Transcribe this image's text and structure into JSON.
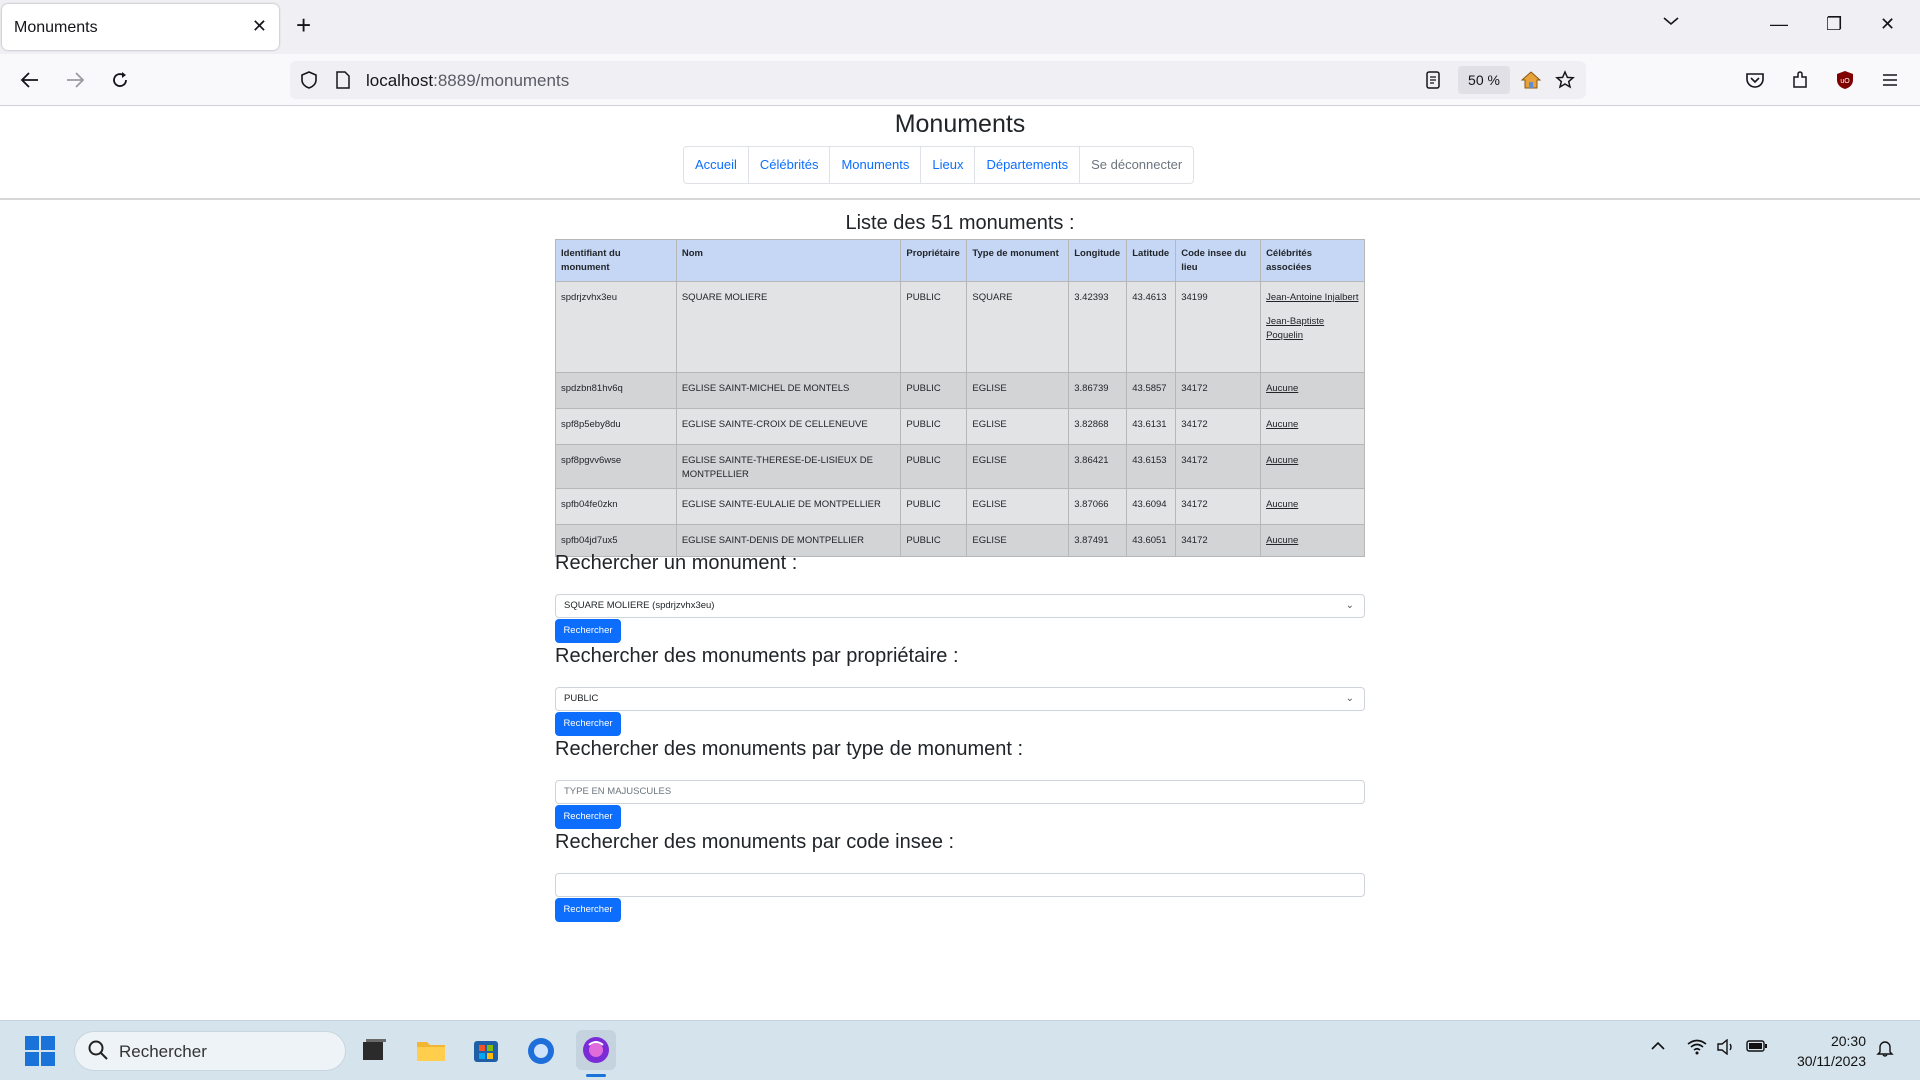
{
  "browser": {
    "tab_title": "Monuments",
    "url_host": "localhost",
    "url_rest": ":8889/monuments",
    "zoom": "50 %"
  },
  "page": {
    "title": "Monuments",
    "menu": [
      "Accueil",
      "Célébrités",
      "Monuments",
      "Lieux",
      "Départements",
      "Se déconnecter"
    ],
    "list_title": "Liste des 51 monuments :",
    "table": {
      "headers": [
        "Identifiant du monument",
        "Nom",
        "Propriétaire",
        "Type de monument",
        "Longitude",
        "Latitude",
        "Code insee du lieu",
        "Célébrités associées"
      ],
      "rows": [
        {
          "id": "spdrjzvhx3eu",
          "nom": "SQUARE MOLIERE",
          "proprietaire": "PUBLIC",
          "type": "SQUARE",
          "longitude": "3.42393",
          "latitude": "43.4613",
          "insee": "34199",
          "celebrites": [
            "Jean-Antoine Injalbert",
            "Jean-Baptiste Poquelin"
          ]
        },
        {
          "id": "spdzbn81hv6q",
          "nom": "EGLISE SAINT-MICHEL DE MONTELS",
          "proprietaire": "PUBLIC",
          "type": "EGLISE",
          "longitude": "3.86739",
          "latitude": "43.5857",
          "insee": "34172",
          "celebrites": [
            "Aucune"
          ]
        },
        {
          "id": "spf8p5eby8du",
          "nom": "EGLISE SAINTE-CROIX DE CELLENEUVE",
          "proprietaire": "PUBLIC",
          "type": "EGLISE",
          "longitude": "3.82868",
          "latitude": "43.6131",
          "insee": "34172",
          "celebrites": [
            "Aucune"
          ]
        },
        {
          "id": "spf8pgvv6wse",
          "nom": "EGLISE SAINTE-THERESE-DE-LISIEUX DE MONTPELLIER",
          "proprietaire": "PUBLIC",
          "type": "EGLISE",
          "longitude": "3.86421",
          "latitude": "43.6153",
          "insee": "34172",
          "celebrites": [
            "Aucune"
          ]
        },
        {
          "id": "spfb04fe0zkn",
          "nom": "EGLISE SAINTE-EULALIE DE MONTPELLIER",
          "proprietaire": "PUBLIC",
          "type": "EGLISE",
          "longitude": "3.87066",
          "latitude": "43.6094",
          "insee": "34172",
          "celebrites": [
            "Aucune"
          ]
        },
        {
          "id": "spfb04jd7ux5",
          "nom": "EGLISE SAINT-DENIS DE MONTPELLIER",
          "proprietaire": "PUBLIC",
          "type": "EGLISE",
          "longitude": "3.87491",
          "latitude": "43.6051",
          "insee": "34172",
          "celebrites": [
            "Aucune"
          ]
        }
      ]
    },
    "search_monument": {
      "title": "Rechercher un monument :",
      "selected": "SQUARE MOLIERE (spdrjzvhx3eu)",
      "button": "Rechercher"
    },
    "search_owner": {
      "title": "Rechercher des monuments par propriétaire :",
      "selected": "PUBLIC",
      "button": "Rechercher"
    },
    "search_type": {
      "title": "Rechercher des monuments par type de monument :",
      "placeholder": "TYPE EN MAJUSCULES",
      "button": "Rechercher"
    },
    "search_insee": {
      "title": "Rechercher des monuments par code insee :",
      "value": "",
      "button": "Rechercher"
    }
  },
  "taskbar": {
    "search_placeholder": "Rechercher",
    "time": "20:30",
    "date": "30/11/2023"
  }
}
